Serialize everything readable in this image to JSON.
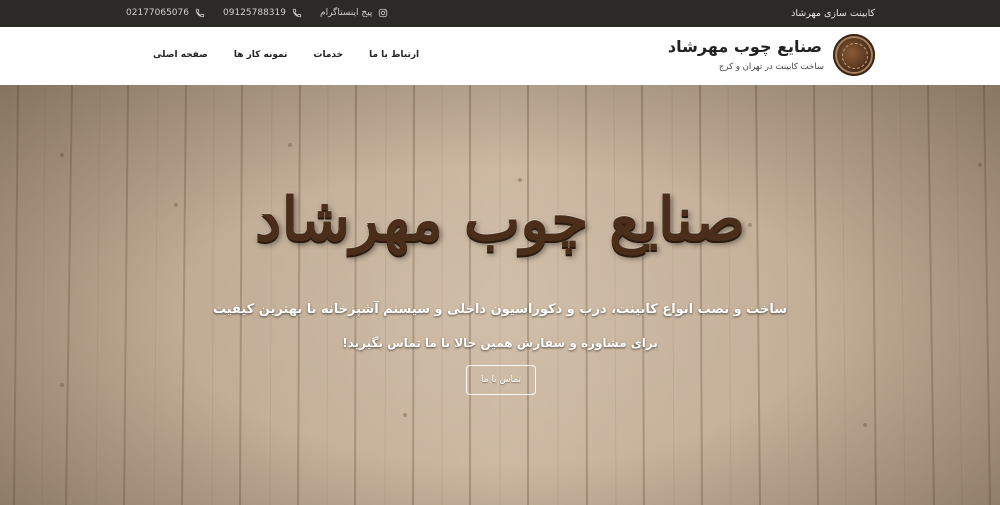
{
  "topbar": {
    "tagline": "کابینت سازی مهرشاد",
    "contacts": [
      {
        "icon": "phone-icon",
        "text": "02177065076"
      },
      {
        "icon": "phone-icon",
        "text": "09125788319"
      },
      {
        "icon": "instagram-icon",
        "text": "پیج اینستاگرام"
      }
    ]
  },
  "header": {
    "brand_title": "صنایع چوب مهرشاد",
    "brand_subtitle": "ساخت کابینت در تهران و کرج",
    "nav": [
      "صفحه اصلی",
      "نمونه کار ها",
      "خدمات",
      "ارتباط با ما"
    ]
  },
  "hero": {
    "title": "صنایع چوب مهرشاد",
    "line1": "ساخت و نصب انواع کابینت، درب و دکوراسیون داخلی و سیستم آشپزخانه با بهترین کیفیت",
    "line2": "برای مشاوره و سفارش همین حالا با ما تماس بگیرید!",
    "button": "تماس با ما"
  },
  "colors": {
    "topbar_bg": "#2c2a27",
    "wood": "#c9b59f",
    "title_brown": "#4a2e1a"
  }
}
